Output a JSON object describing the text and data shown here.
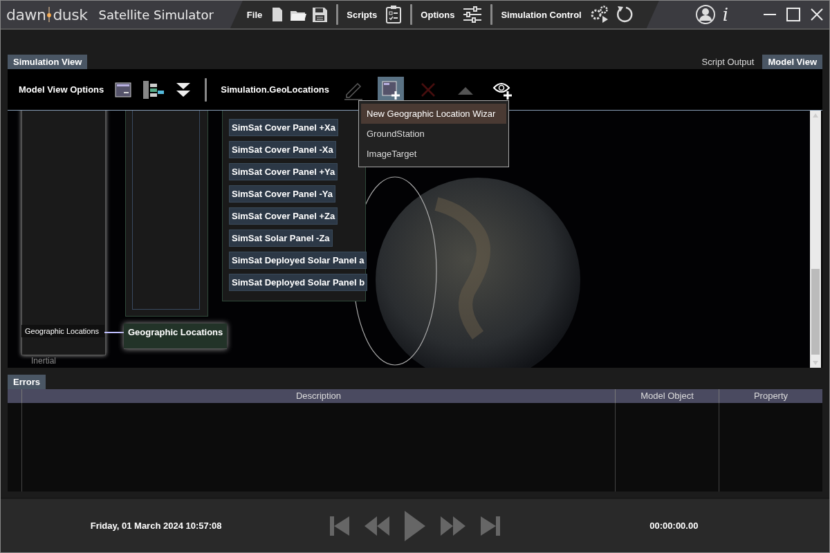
{
  "app": {
    "logo_left": "dawn",
    "logo_right": "dusk",
    "title": "Satellite Simulator"
  },
  "menu": [
    {
      "label": "File"
    },
    {
      "label": "Scripts"
    },
    {
      "label": "Options"
    },
    {
      "label": "Simulation Control"
    }
  ],
  "info_label": "i",
  "left_tabs": [
    {
      "label": "Simulation View",
      "selected": true
    }
  ],
  "right_tabs": [
    {
      "label": "Script Output",
      "selected": false
    },
    {
      "label": "Model View",
      "selected": true
    }
  ],
  "toolbar": {
    "label": "Model View Options",
    "path": "Simulation.GeoLocations",
    "tools": [
      {
        "kind": "edit",
        "disabled": true,
        "selected": false
      },
      {
        "kind": "add",
        "disabled": false,
        "selected": true
      },
      {
        "kind": "delete",
        "disabled": true,
        "selected": false
      },
      {
        "kind": "up",
        "disabled": true,
        "selected": false
      },
      {
        "kind": "view",
        "disabled": false,
        "selected": false
      }
    ]
  },
  "dropdown": [
    {
      "label": "New Geographic Location Wizar",
      "selected": true
    },
    {
      "label": "GroundStation",
      "selected": false
    },
    {
      "label": "ImageTarget",
      "selected": false
    }
  ],
  "canvas": {
    "nodes": [
      {
        "label": "Geographic Locations",
        "kind": "plain"
      },
      {
        "label": "Geographic Locations",
        "kind": "highlight"
      }
    ],
    "inertial_label": "Inertial",
    "panels": [
      "SimSat Cover Panel +Xa",
      "SimSat Cover Panel -Xa",
      "SimSat Cover Panel +Ya",
      "SimSat Cover Panel -Ya",
      "SimSat Cover Panel +Za",
      "SimSat Solar Panel -Za",
      "SimSat Deployed Solar Panel a",
      "SimSat Deployed Solar Panel b"
    ]
  },
  "errors": {
    "tab": "Errors",
    "columns": [
      "Description",
      "Model Object",
      "Property"
    ]
  },
  "footer": {
    "date": "Friday, 01 March 2024 10:57:08",
    "elapsed": "00:00:00.00"
  }
}
